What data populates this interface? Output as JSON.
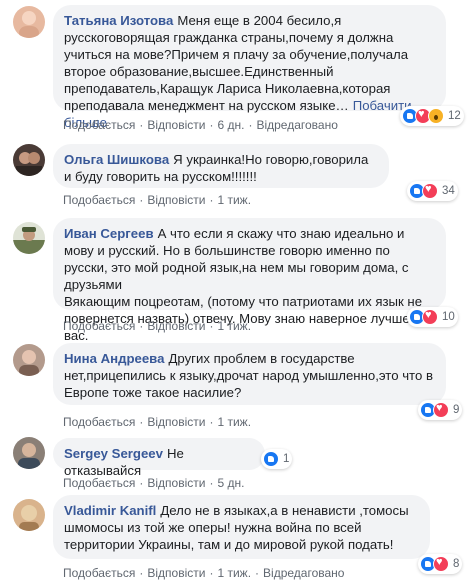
{
  "comments": [
    {
      "author": "Татьяна Изотова",
      "text": "Меня еще в 2004 бесило,я русскоговорящая гражданка страны,почему я должна учиться на мове?Причем я плачу за обучение,получала второе образование,высшее.Единственный преподаватель,Каращук Лариса Николаевна,которая преподавала менеджмент на русском языке…",
      "more": "Побачити більше",
      "like": "Подобається",
      "reply": "Відповісти",
      "time": "6 дн.",
      "edited": "Відредаговано",
      "reactions": [
        "like",
        "love",
        "wow"
      ],
      "count": "12",
      "avatar_color": "#e7b9a0"
    },
    {
      "author": "Ольга Шишкова",
      "text": "Я украинка!Но говорю,говорила и буду говорить на русском!!!!!!!",
      "like": "Подобається",
      "reply": "Відповісти",
      "time": "1 тиж.",
      "reactions": [
        "like",
        "love"
      ],
      "count": "34",
      "avatar_color": "#4a3b36"
    },
    {
      "author": "Иван Сергеев",
      "text": "А что если я скажу что знаю идеально и мову и русский. Но в большинстве говорю именно по русски, это мой родной язык,на нем мы говорим дома, с друзьями\nВякающим поцреотам, (потому что патриотами их язык не повернется назвать) отвечу. Мову знаю наверное лучше вас.",
      "like": "Подобається",
      "reply": "Відповісти",
      "time": "1 тиж.",
      "reactions": [
        "like",
        "love"
      ],
      "count": "10",
      "avatar_color": "#6b7a4f"
    },
    {
      "author": "Нина Андреева",
      "text": "Других проблем в государстве нет,прицепились к языку,дрочат народ умышленно,это что в Европе тоже такое насилие?",
      "like": "Подобається",
      "reply": "Відповісти",
      "time": "1 тиж.",
      "reactions": [
        "like",
        "love"
      ],
      "count": "9",
      "avatar_color": "#b39a8c"
    },
    {
      "author": "Sergey Sergeev",
      "text": "Не отказывайся",
      "like": "Подобається",
      "reply": "Відповісти",
      "time": "5 дн.",
      "reactions": [
        "like"
      ],
      "count": "1",
      "avatar_color": "#8a7f76"
    },
    {
      "author": "Vladimir Kanifl",
      "text": "Дело не в языках,а в ненависти ,томосы шмомосы из той же оперы! нужна война по всей территории Украины, там и до мировой рукой подать!",
      "like": "Подобається",
      "reply": "Відповісти",
      "time": "1 тиж.",
      "edited": "Відредаговано",
      "reactions": [
        "like",
        "love"
      ],
      "count": "8",
      "avatar_color": "#d9b38c"
    }
  ]
}
